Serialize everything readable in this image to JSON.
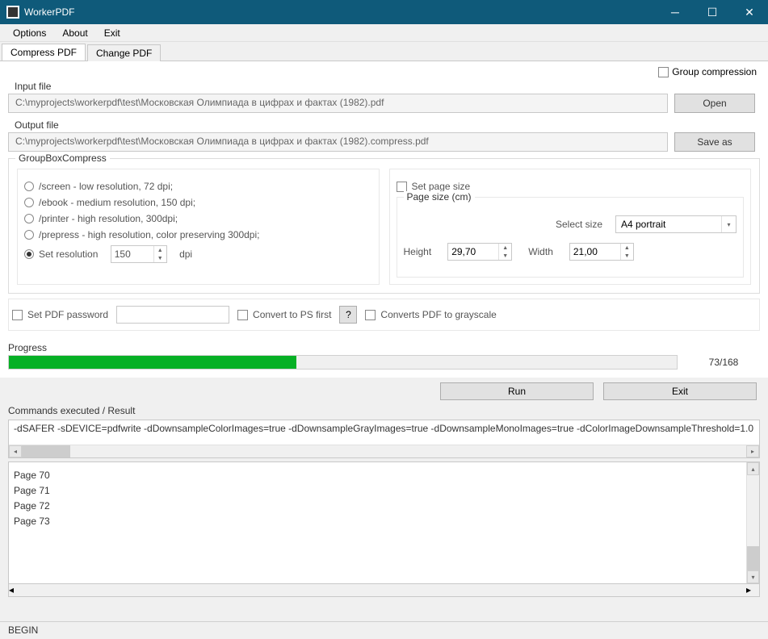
{
  "window": {
    "title": "WorkerPDF"
  },
  "menu": {
    "options": "Options",
    "about": "About",
    "exit": "Exit"
  },
  "tabs": {
    "compress": "Compress PDF",
    "change": "Change PDF"
  },
  "group_compression_label": "Group compression",
  "input": {
    "label": "Input file",
    "path": "C:\\myprojects\\workerpdf\\test\\Московская Олимпиада в цифрах и фактах (1982).pdf",
    "button": "Open"
  },
  "output": {
    "label": "Output file",
    "path": "C:\\myprojects\\workerpdf\\test\\Московская Олимпиада в цифрах и фактах (1982).compress.pdf",
    "button": "Save as"
  },
  "compress": {
    "title": "GroupBoxCompress",
    "presets": [
      "/screen - low resolution, 72 dpi;",
      "/ebook - medium resolution, 150 dpi;",
      "/printer - high resolution, 300dpi;",
      "/prepress - high resolution, color preserving 300dpi;"
    ],
    "set_resolution_label": "Set resolution",
    "dpi_value": "150",
    "dpi_unit": "dpi"
  },
  "page_size": {
    "set_page_size": "Set page size",
    "group_title": "Page size (cm)",
    "select_size_label": "Select size",
    "select_size_value": "A4 portrait",
    "height_label": "Height",
    "height_value": "29,70",
    "width_label": "Width",
    "width_value": "21,00"
  },
  "options_row": {
    "set_pdf_password": "Set PDF password",
    "convert_ps": "Convert to PS first",
    "help": "?",
    "grayscale": "Converts PDF to grayscale"
  },
  "progress": {
    "label": "Progress",
    "text": "73/168",
    "percent": 43
  },
  "buttons": {
    "run": "Run",
    "exit": "Exit"
  },
  "commands": {
    "label": "Commands executed / Result",
    "text": "-dSAFER -sDEVICE=pdfwrite -dDownsampleColorImages=true -dDownsampleGrayImages=true -dDownsampleMonoImages=true -dColorImageDownsampleThreshold=1.0"
  },
  "log": {
    "lines": [
      "Page 70",
      "Page 71",
      "Page 72",
      "Page 73"
    ]
  },
  "status": "BEGIN"
}
